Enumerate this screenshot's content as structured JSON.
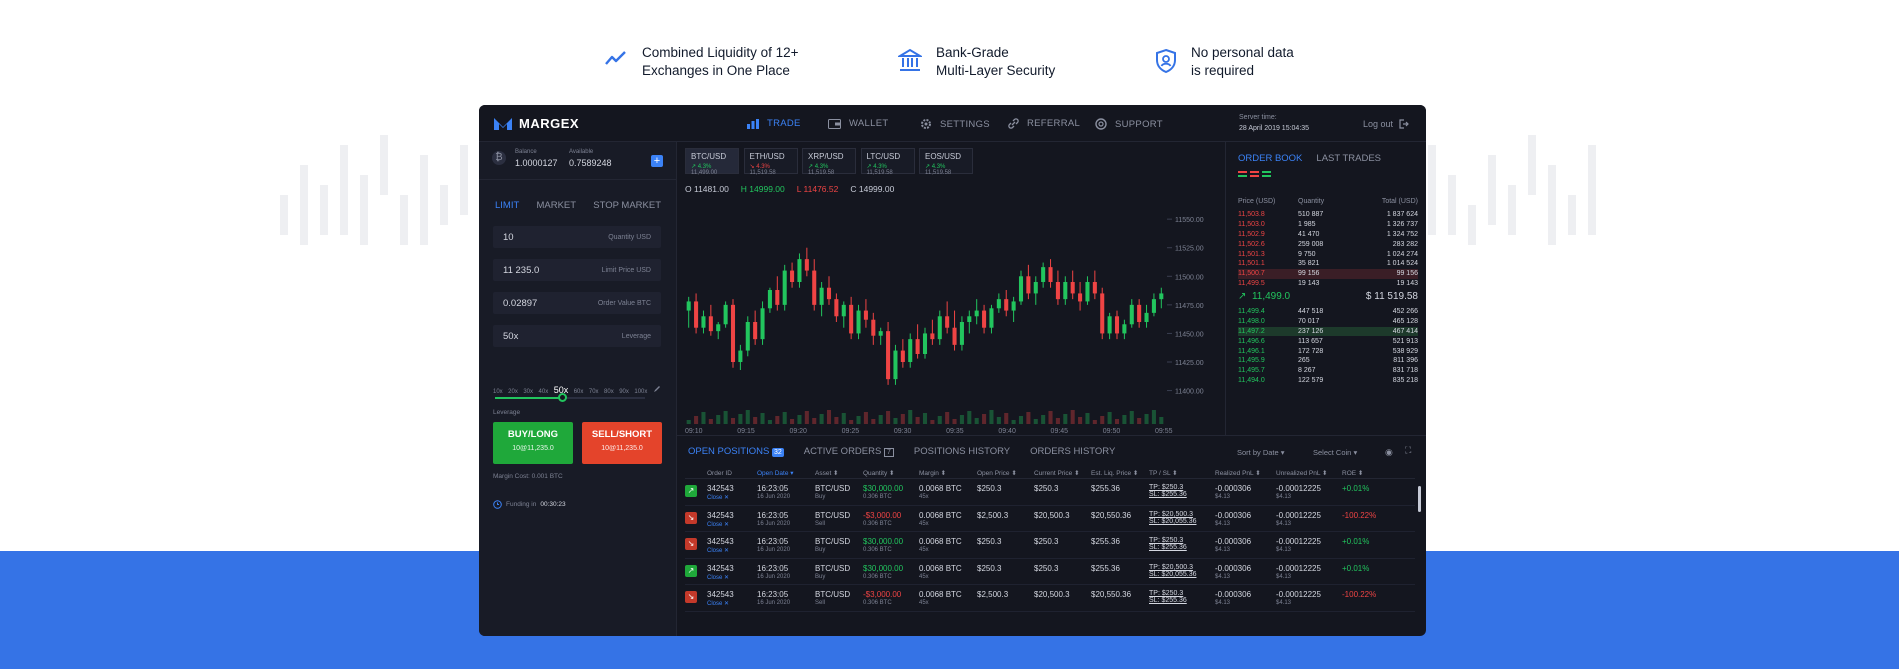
{
  "features": [
    {
      "line1": "Combined Liquidity of 12+",
      "line2": "Exchanges in One Place"
    },
    {
      "line1": "Bank-Grade",
      "line2": "Multi-Layer Security"
    },
    {
      "line1": "No personal data",
      "line2": "is required"
    }
  ],
  "app": {
    "logo": "MARGEX",
    "nav": [
      "TRADE",
      "WALLET",
      "SETTINGS",
      "REFERRAL",
      "SUPPORT"
    ],
    "server_label": "Server time:",
    "server_time": "28 April 2019 15:04:35",
    "logout": "Log out"
  },
  "left": {
    "balance_label": "Balance",
    "balance": "1.0000127",
    "available_label": "Available",
    "available": "0.7589248",
    "order_tabs": [
      "LIMIT",
      "MARKET",
      "STOP MARKET"
    ],
    "fields": [
      {
        "value": "10",
        "label": "Quantity USD"
      },
      {
        "value": "11 235.0",
        "label": "Limit Price USD"
      },
      {
        "value": "0.02897",
        "label": "Order Value BTC"
      },
      {
        "value": "50x",
        "label": "Leverage"
      }
    ],
    "leverage_ticks": [
      "10x",
      "20x",
      "30x",
      "40x",
      "50x",
      "60x",
      "70x",
      "80x",
      "90x",
      "100x"
    ],
    "leverage_selected": "50x",
    "leverage_label": "Leverage",
    "buy_label": "BUY/LONG",
    "buy_sub": "10@11,235.0",
    "sell_label": "SELL/SHORT",
    "sell_sub": "10@11,235.0",
    "margin_cost": "Margin Cost: 0.001 BTC",
    "funding_label": "Funding in",
    "funding_time": "00:30:23"
  },
  "pairs": [
    {
      "name": "BTC/USD",
      "change": "4.3%",
      "price": "11,499.00"
    },
    {
      "name": "ETH/USD",
      "change": "4.3%",
      "price": "11,519.58"
    },
    {
      "name": "XRP/USD",
      "change": "4.3%",
      "price": "11,519.58"
    },
    {
      "name": "LTC/USD",
      "change": "4.3%",
      "price": "11,519.58"
    },
    {
      "name": "EOS/USD",
      "change": "4.3%",
      "price": "11,519.58"
    }
  ],
  "ohlc": {
    "o": "O 11481.00",
    "h": "H 14999.00",
    "l": "L 11476.52",
    "c": "C 14999.00"
  },
  "chart_data": {
    "type": "candlestick",
    "y_ticks": [
      "11550.00",
      "11525.00",
      "11500.00",
      "11475.00",
      "11450.00",
      "11425.00",
      "11400.00"
    ],
    "x_ticks": [
      "09:10",
      "09:15",
      "09:20",
      "09:25",
      "09:30",
      "09:35",
      "09:40",
      "09:45",
      "09:50",
      "09:55"
    ],
    "ylim": [
      11390,
      11565
    ],
    "candles": [
      [
        11470,
        11482,
        11455,
        11478
      ],
      [
        11478,
        11485,
        11450,
        11455
      ],
      [
        11455,
        11470,
        11450,
        11465
      ],
      [
        11465,
        11475,
        11448,
        11452
      ],
      [
        11452,
        11460,
        11445,
        11458
      ],
      [
        11458,
        11478,
        11455,
        11475
      ],
      [
        11475,
        11480,
        11420,
        11425
      ],
      [
        11425,
        11440,
        11418,
        11435
      ],
      [
        11435,
        11465,
        11430,
        11460
      ],
      [
        11460,
        11470,
        11440,
        11445
      ],
      [
        11445,
        11478,
        11440,
        11472
      ],
      [
        11472,
        11490,
        11468,
        11488
      ],
      [
        11488,
        11500,
        11470,
        11475
      ],
      [
        11475,
        11510,
        11470,
        11505
      ],
      [
        11505,
        11512,
        11490,
        11495
      ],
      [
        11495,
        11520,
        11490,
        11515
      ],
      [
        11515,
        11525,
        11500,
        11505
      ],
      [
        11505,
        11515,
        11470,
        11475
      ],
      [
        11475,
        11495,
        11465,
        11490
      ],
      [
        11490,
        11500,
        11475,
        11480
      ],
      [
        11480,
        11485,
        11460,
        11465
      ],
      [
        11465,
        11478,
        11455,
        11475
      ],
      [
        11475,
        11482,
        11445,
        11450
      ],
      [
        11450,
        11475,
        11445,
        11470
      ],
      [
        11470,
        11480,
        11455,
        11462
      ],
      [
        11462,
        11468,
        11440,
        11448
      ],
      [
        11448,
        11455,
        11440,
        11452
      ],
      [
        11452,
        11460,
        11405,
        11410
      ],
      [
        11410,
        11440,
        11405,
        11435
      ],
      [
        11435,
        11445,
        11420,
        11425
      ],
      [
        11425,
        11450,
        11420,
        11445
      ],
      [
        11445,
        11458,
        11428,
        11432
      ],
      [
        11432,
        11455,
        11428,
        11450
      ],
      [
        11450,
        11462,
        11440,
        11445
      ],
      [
        11445,
        11470,
        11440,
        11465
      ],
      [
        11465,
        11478,
        11450,
        11455
      ],
      [
        11455,
        11470,
        11435,
        11440
      ],
      [
        11440,
        11465,
        11435,
        11460
      ],
      [
        11460,
        11470,
        11450,
        11465
      ],
      [
        11465,
        11480,
        11458,
        11470
      ],
      [
        11470,
        11475,
        11450,
        11455
      ],
      [
        11455,
        11475,
        11450,
        11472
      ],
      [
        11472,
        11485,
        11468,
        11480
      ],
      [
        11480,
        11488,
        11465,
        11470
      ],
      [
        11470,
        11482,
        11460,
        11478
      ],
      [
        11478,
        11505,
        11475,
        11500
      ],
      [
        11500,
        11510,
        11480,
        11485
      ],
      [
        11485,
        11500,
        11475,
        11495
      ],
      [
        11495,
        11512,
        11490,
        11508
      ],
      [
        11508,
        11515,
        11490,
        11495
      ],
      [
        11495,
        11505,
        11475,
        11480
      ],
      [
        11480,
        11500,
        11475,
        11495
      ],
      [
        11495,
        11505,
        11480,
        11485
      ],
      [
        11485,
        11495,
        11470,
        11478
      ],
      [
        11478,
        11500,
        11475,
        11495
      ],
      [
        11495,
        11505,
        11480,
        11485
      ],
      [
        11485,
        11490,
        11445,
        11450
      ],
      [
        11450,
        11468,
        11445,
        11465
      ],
      [
        11465,
        11470,
        11445,
        11450
      ],
      [
        11450,
        11462,
        11445,
        11458
      ],
      [
        11458,
        11480,
        11455,
        11475
      ],
      [
        11475,
        11480,
        11455,
        11460
      ],
      [
        11460,
        11475,
        11455,
        11468
      ],
      [
        11468,
        11485,
        11465,
        11480
      ],
      [
        11480,
        11490,
        11472,
        11485
      ]
    ]
  },
  "orderbook": {
    "tabs": [
      "ORDER BOOK",
      "LAST TRADES"
    ],
    "headers": [
      "Price (USD)",
      "Quantity",
      "Total (USD)"
    ],
    "asks": [
      [
        "11,503.8",
        "510 887",
        "1 837 624"
      ],
      [
        "11,503.0",
        "1 985",
        "1 326 737"
      ],
      [
        "11,502.9",
        "41 470",
        "1 324 752"
      ],
      [
        "11,502.6",
        "259 008",
        "283 282"
      ],
      [
        "11,501.3",
        "9 750",
        "1 024 274"
      ],
      [
        "11,501.1",
        "35 821",
        "1 014 524"
      ],
      [
        "11,500.7",
        "99 156",
        "99 156"
      ],
      [
        "11,499.5",
        "19 143",
        "19 143"
      ]
    ],
    "mid_price": "11,499.0",
    "mid_usd": "$ 11 519.58",
    "bids": [
      [
        "11,499.4",
        "447 518",
        "452 266"
      ],
      [
        "11,498.0",
        "70 017",
        "465 128"
      ],
      [
        "11,497.2",
        "237 126",
        "467 414"
      ],
      [
        "11,496.6",
        "113 657",
        "521 913"
      ],
      [
        "11,496.1",
        "172 728",
        "538 929"
      ],
      [
        "11,495.9",
        "265",
        "811 396"
      ],
      [
        "11,495.7",
        "8 267",
        "831 718"
      ],
      [
        "11,494.0",
        "122 579",
        "835 218"
      ]
    ]
  },
  "bottom": {
    "tabs": [
      "OPEN POSITIONS",
      "ACTIVE ORDERS",
      "POSITIONS HISTORY",
      "ORDERS HISTORY"
    ],
    "open_count": "32",
    "active_count": "7",
    "sort_label": "Sort by Date",
    "coin_label": "Select Coin",
    "headers": [
      "",
      "Order ID",
      "Open Date",
      "Asset",
      "Quantity",
      "Margin",
      "Open Price",
      "Current Price",
      "Est. Liq. Price",
      "TP / SL",
      "Realized PnL",
      "Unrealized PnL",
      "ROE"
    ],
    "rows": [
      {
        "dir": "up",
        "id": "342543",
        "action": "Close",
        "time": "16:23:05",
        "date": "16 Jun 2020",
        "asset": "BTC/USD",
        "side": "Buy",
        "qty": "$30,000.00",
        "qty_sub": "0.306 BTC",
        "margin": "0.0068 BTC",
        "lev": "45x",
        "open": "$250.3",
        "current": "$250.3",
        "liq": "$255.36",
        "tp": "TP: $250.3",
        "sl": "SL: $255.36",
        "rpnl": "-0.000306",
        "rpnl_sub": "$4.13",
        "upnl": "-0.00012225",
        "upnl_sub": "$4.13",
        "roe": "+0.01%"
      },
      {
        "dir": "down",
        "id": "342543",
        "action": "Close",
        "time": "16:23:05",
        "date": "16 Jun 2020",
        "asset": "BTC/USD",
        "side": "Sell",
        "qty": "-$3,000.00",
        "qty_sub": "0.306 BTC",
        "margin": "0.0068 BTC",
        "lev": "45x",
        "open": "$2,500.3",
        "current": "$20,500.3",
        "liq": "$20,550.36",
        "tp": "TP: $20,500.3",
        "sl": "SL: $20,055.36",
        "rpnl": "-0.000306",
        "rpnl_sub": "$4.13",
        "upnl": "-0.00012225",
        "upnl_sub": "$4.13",
        "roe": "-100.22%"
      },
      {
        "dir": "down",
        "id": "342543",
        "action": "Close",
        "time": "16:23:05",
        "date": "16 Jun 2020",
        "asset": "BTC/USD",
        "side": "Buy",
        "qty": "$30,000.00",
        "qty_sub": "0.306 BTC",
        "margin": "0.0068 BTC",
        "lev": "45x",
        "open": "$250.3",
        "current": "$250.3",
        "liq": "$255.36",
        "tp": "TP: $250.3",
        "sl": "SL: $255.36",
        "rpnl": "-0.000306",
        "rpnl_sub": "$4.13",
        "upnl": "-0.00012225",
        "upnl_sub": "$4.13",
        "roe": "+0.01%"
      },
      {
        "dir": "up",
        "id": "342543",
        "action": "Close",
        "time": "16:23:05",
        "date": "16 Jun 2020",
        "asset": "BTC/USD",
        "side": "Buy",
        "qty": "$30,000.00",
        "qty_sub": "0.306 BTC",
        "margin": "0.0068 BTC",
        "lev": "45x",
        "open": "$250.3",
        "current": "$250.3",
        "liq": "$255.36",
        "tp": "TP: $20,500.3",
        "sl": "SL: $20,055.36",
        "rpnl": "-0.000306",
        "rpnl_sub": "$4.13",
        "upnl": "-0.00012225",
        "upnl_sub": "$4.13",
        "roe": "+0.01%"
      },
      {
        "dir": "down",
        "id": "342543",
        "action": "Close",
        "time": "16:23:05",
        "date": "16 Jun 2020",
        "asset": "BTC/USD",
        "side": "Sell",
        "qty": "-$3,000.00",
        "qty_sub": "0.306 BTC",
        "margin": "0.0068 BTC",
        "lev": "45x",
        "open": "$2,500.3",
        "current": "$20,500.3",
        "liq": "$20,550.36",
        "tp": "TP: $250.3",
        "sl": "SL: $255.36",
        "rpnl": "-0.000306",
        "rpnl_sub": "$4.13",
        "upnl": "-0.00012225",
        "upnl_sub": "$4.13",
        "roe": "-100.22%"
      }
    ]
  },
  "colors": {
    "accent": "#3b82f6",
    "green": "#22c55e",
    "red": "#ef4444",
    "bg": "#14161f",
    "brand_blue": "#3573e6"
  }
}
